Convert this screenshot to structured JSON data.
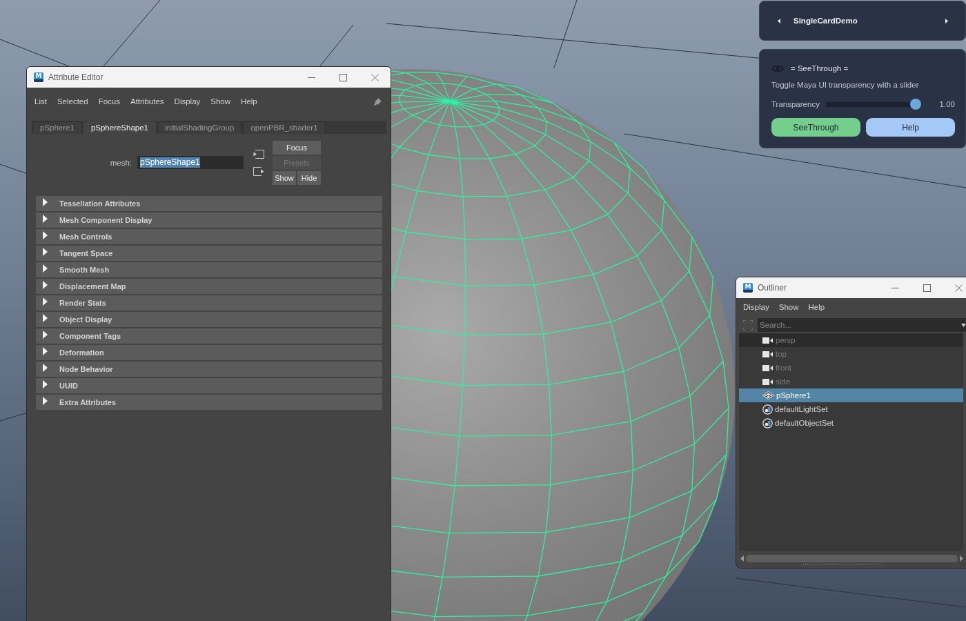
{
  "attribute_editor": {
    "logo": "M",
    "title": "Attribute Editor",
    "menu": [
      "List",
      "Selected",
      "Focus",
      "Attributes",
      "Display",
      "Show",
      "Help"
    ],
    "tabs": [
      {
        "label": "pSphere1",
        "selected": false
      },
      {
        "label": "pSphereShape1",
        "selected": true
      },
      {
        "label": "initialShadingGroup",
        "selected": false
      },
      {
        "label": "openPBR_shader1",
        "selected": false
      }
    ],
    "mesh_field": {
      "label": "mesh:",
      "value": "pSphereShape1",
      "value_selected": true
    },
    "buttons": [
      {
        "label": "Focus",
        "disabled": false
      },
      {
        "label": "Presets",
        "disabled": true
      },
      {
        "label": "Show",
        "disabled": false
      },
      {
        "label": "Hide",
        "disabled": false
      }
    ],
    "sections": [
      {
        "label": "Tessellation Attributes",
        "expanded": false
      },
      {
        "label": "Mesh Component Display",
        "expanded": false
      },
      {
        "label": "Mesh Controls",
        "expanded": false
      },
      {
        "label": "Tangent Space",
        "expanded": false
      },
      {
        "label": "Smooth Mesh",
        "expanded": false
      },
      {
        "label": "Displacement Map",
        "expanded": false
      },
      {
        "label": "Render Stats",
        "expanded": false
      },
      {
        "label": "Object Display",
        "expanded": false
      },
      {
        "label": "Component Tags",
        "expanded": false
      },
      {
        "label": "Deformation",
        "expanded": false
      },
      {
        "label": "Node Behavior",
        "expanded": false
      },
      {
        "label": "UUID",
        "expanded": false
      },
      {
        "label": "Extra Attributes",
        "expanded": false
      }
    ]
  },
  "card_carousel": {
    "title": "SingleCardDemo"
  },
  "see_through_card": {
    "heading": "= SeeThrough =",
    "description": "Toggle Maya UI transparency with a slider",
    "slider": {
      "label": "Transparency",
      "level": 1.0,
      "reading": "1.00"
    },
    "buttons": [
      {
        "label": "SeeThrough",
        "kind": "toggle"
      },
      {
        "label": "Help",
        "kind": "help"
      }
    ]
  },
  "outliner": {
    "logo": "M",
    "title": "Outliner",
    "menu": [
      "Display",
      "Show",
      "Help"
    ],
    "search": {
      "placeholder": "Search..."
    },
    "items": [
      {
        "label": "persp",
        "kind": "camera",
        "selected": false,
        "dimmed": true,
        "hovered": true
      },
      {
        "label": "top",
        "kind": "camera",
        "selected": false,
        "dimmed": true,
        "hovered": false
      },
      {
        "label": "front",
        "kind": "camera",
        "selected": false,
        "dimmed": true,
        "hovered": false
      },
      {
        "label": "side",
        "kind": "camera",
        "selected": false,
        "dimmed": true,
        "hovered": false
      },
      {
        "label": "pSphere1",
        "kind": "transform",
        "selected": true,
        "dimmed": false,
        "hovered": false
      },
      {
        "label": "defaultLightSet",
        "kind": "set",
        "selected": false,
        "dimmed": false,
        "hovered": false
      },
      {
        "label": "defaultObjectSet",
        "kind": "set",
        "selected": false,
        "dimmed": false,
        "hovered": false
      }
    ]
  }
}
